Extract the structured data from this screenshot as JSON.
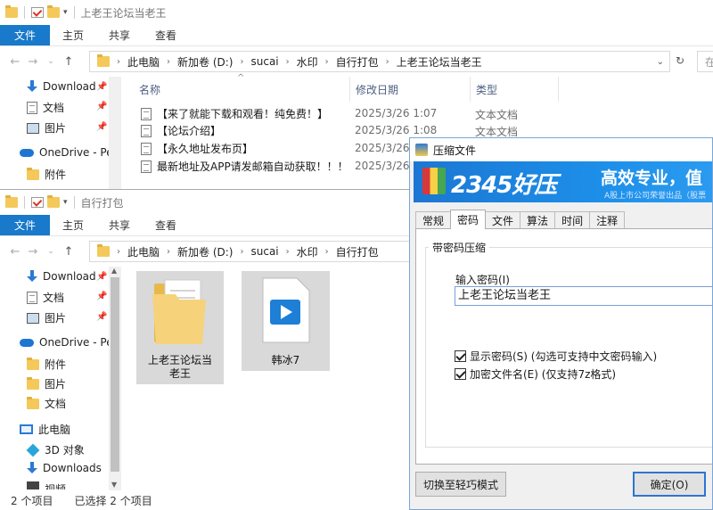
{
  "back_window": {
    "title": "上老王论坛当老王",
    "ribbon_tabs": [
      "文件",
      "主页",
      "共享",
      "查看"
    ],
    "breadcrumb": [
      "此电脑",
      "新加卷 (D:)",
      "sucai",
      "水印",
      "自行打包",
      "上老王论坛当老王"
    ],
    "search_placeholder": "在",
    "sidebar": [
      {
        "label": "Download",
        "icon": "download-icon",
        "pinned": true
      },
      {
        "label": "文档",
        "icon": "document-icon",
        "pinned": true
      },
      {
        "label": "图片",
        "icon": "picture-icon",
        "pinned": true
      },
      {
        "label": "OneDrive - Per",
        "icon": "onedrive-icon",
        "pinned": false
      },
      {
        "label": "附件",
        "icon": "folder-icon",
        "pinned": false
      }
    ],
    "columns": {
      "name": "名称",
      "date": "修改日期",
      "type": "类型"
    },
    "files": [
      {
        "name": "【来了就能下载和观看！纯免费！】",
        "date": "2025/3/26 1:07",
        "type": "文本文档"
      },
      {
        "name": "【论坛介绍】",
        "date": "2025/3/26 1:08",
        "type": "文本文档"
      },
      {
        "name": "【永久地址发布页】",
        "date": "2025/3/26",
        "type": ""
      },
      {
        "name": "最新地址及APP请发邮箱自动获取！！！",
        "date": "2025/3/26",
        "type": ""
      }
    ]
  },
  "front_window": {
    "title": "自行打包",
    "ribbon_tabs": [
      "文件",
      "主页",
      "共享",
      "查看"
    ],
    "breadcrumb": [
      "此电脑",
      "新加卷 (D:)",
      "sucai",
      "水印",
      "自行打包"
    ],
    "sidebar": [
      {
        "label": "Download",
        "icon": "download-icon",
        "pinned": true
      },
      {
        "label": "文档",
        "icon": "document-icon",
        "pinned": true
      },
      {
        "label": "图片",
        "icon": "picture-icon",
        "pinned": true
      },
      {
        "label": "OneDrive - Per",
        "icon": "onedrive-icon",
        "pinned": false
      },
      {
        "label": "附件",
        "icon": "folder-icon",
        "pinned": false
      },
      {
        "label": "图片",
        "icon": "folder-icon",
        "pinned": false
      },
      {
        "label": "文档",
        "icon": "folder-icon",
        "pinned": false
      },
      {
        "label": "此电脑",
        "icon": "this-pc-icon",
        "pinned": false
      },
      {
        "label": "3D 对象",
        "icon": "3d-objects-icon",
        "pinned": false
      },
      {
        "label": "Downloads",
        "icon": "download-icon",
        "pinned": false
      },
      {
        "label": "视频",
        "icon": "video-icon",
        "pinned": false
      }
    ],
    "items": [
      {
        "name": "上老王论坛当老王",
        "icon": "folder-icon",
        "selected": true
      },
      {
        "name": "韩冰7",
        "icon": "video-file-icon",
        "selected": true
      }
    ],
    "status": {
      "count": "2 个项目",
      "selected": "已选择 2 个项目"
    }
  },
  "dialog": {
    "title": "压缩文件",
    "banner": {
      "product": "2345好压",
      "slogan": "高效专业，值",
      "subtitle": "A股上市公司荣誉出品（股票"
    },
    "tabs": [
      "常规",
      "密码",
      "文件",
      "算法",
      "时间",
      "注释"
    ],
    "active_tab": "密码",
    "group_title": "带密码压缩",
    "password_label": "输入密码(I)",
    "password_value": "上老王论坛当老王",
    "show_password": {
      "label": "显示密码(S)  (勾选可支持中文密码输入)",
      "checked": true
    },
    "encrypt_names": {
      "label": "加密文件名(E)  (仅支持7z格式)",
      "checked": true
    },
    "switch_button": "切换至轻巧模式",
    "ok_button": "确定(O)"
  },
  "colors": {
    "accent": "#1979ca",
    "selection": "#d9d9d9",
    "banner": "#1b77d3"
  }
}
